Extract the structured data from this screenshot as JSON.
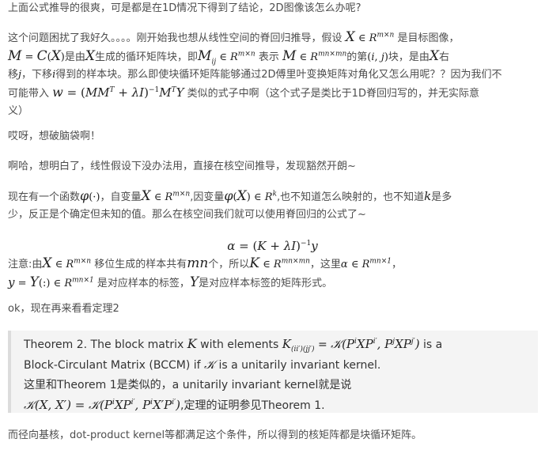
{
  "p1": "上面公式推导的很爽，可是都是在1D情况下得到了结论，2D图像该怎么办呢?",
  "p2": {
    "a": "这个问题困扰了我好久。。。。刚开始我也想从线性空间的脊回归推导，假设",
    "b": "是目标图像，",
    "c": "是由",
    "d": "生成的循环矩阵块，即",
    "e": "表示",
    "f": "的第",
    "g": "块，是由",
    "h": "右",
    "i": "移",
    "j": "，下移",
    "k": "得到的样本块。那么即使块循环矩阵能够通过2D傅里叶变换矩阵对角化又怎么用呢？？因为我们不",
    "l": "可能带入",
    "m": "类似的式子中啊（这个式子是类比于1D脊回归写的，并无实际意",
    "n": "义）"
  },
  "p3": "哎呀，想破脑袋啊！",
  "p4": "啊哈，想明白了，线性假设下没办法用，直接在核空间推导，发现豁然开朗~",
  "p5": {
    "a": "现在有一个函数",
    "b": "，自变量",
    "c": ",因变量",
    "d": ",也不知道怎么映射的，也不知道",
    "e": "是多",
    "f": "少，反正是个确定但未知的值。那么在核空间我们就可以使用脊回归的公式了~"
  },
  "p6": {
    "a": "注意:由",
    "b": "移位生成的样本共有",
    "c": "个，所以",
    "d": "，这里",
    "e": "，",
    "f": "是对应样本的标签，",
    "g": "是对应样本标签的矩阵形式。"
  },
  "p7": "ok，现在再来看看定理2",
  "quote": {
    "a": "Theorem 2. The block matrix",
    "b": "with elements",
    "c": "is a",
    "d": "Block-Circulant Matrix (BCCM) if",
    "e": "is a unitarily invariant kernel.",
    "f": "这里和Theorem 1是类似的，a unitarily invariant kernel就是说",
    "g": ",定理的证明参见Theorem 1."
  },
  "p8": "而径向基核，dot-product kernel等都满足这个条件，所以得到的核矩阵都是块循环矩阵。"
}
